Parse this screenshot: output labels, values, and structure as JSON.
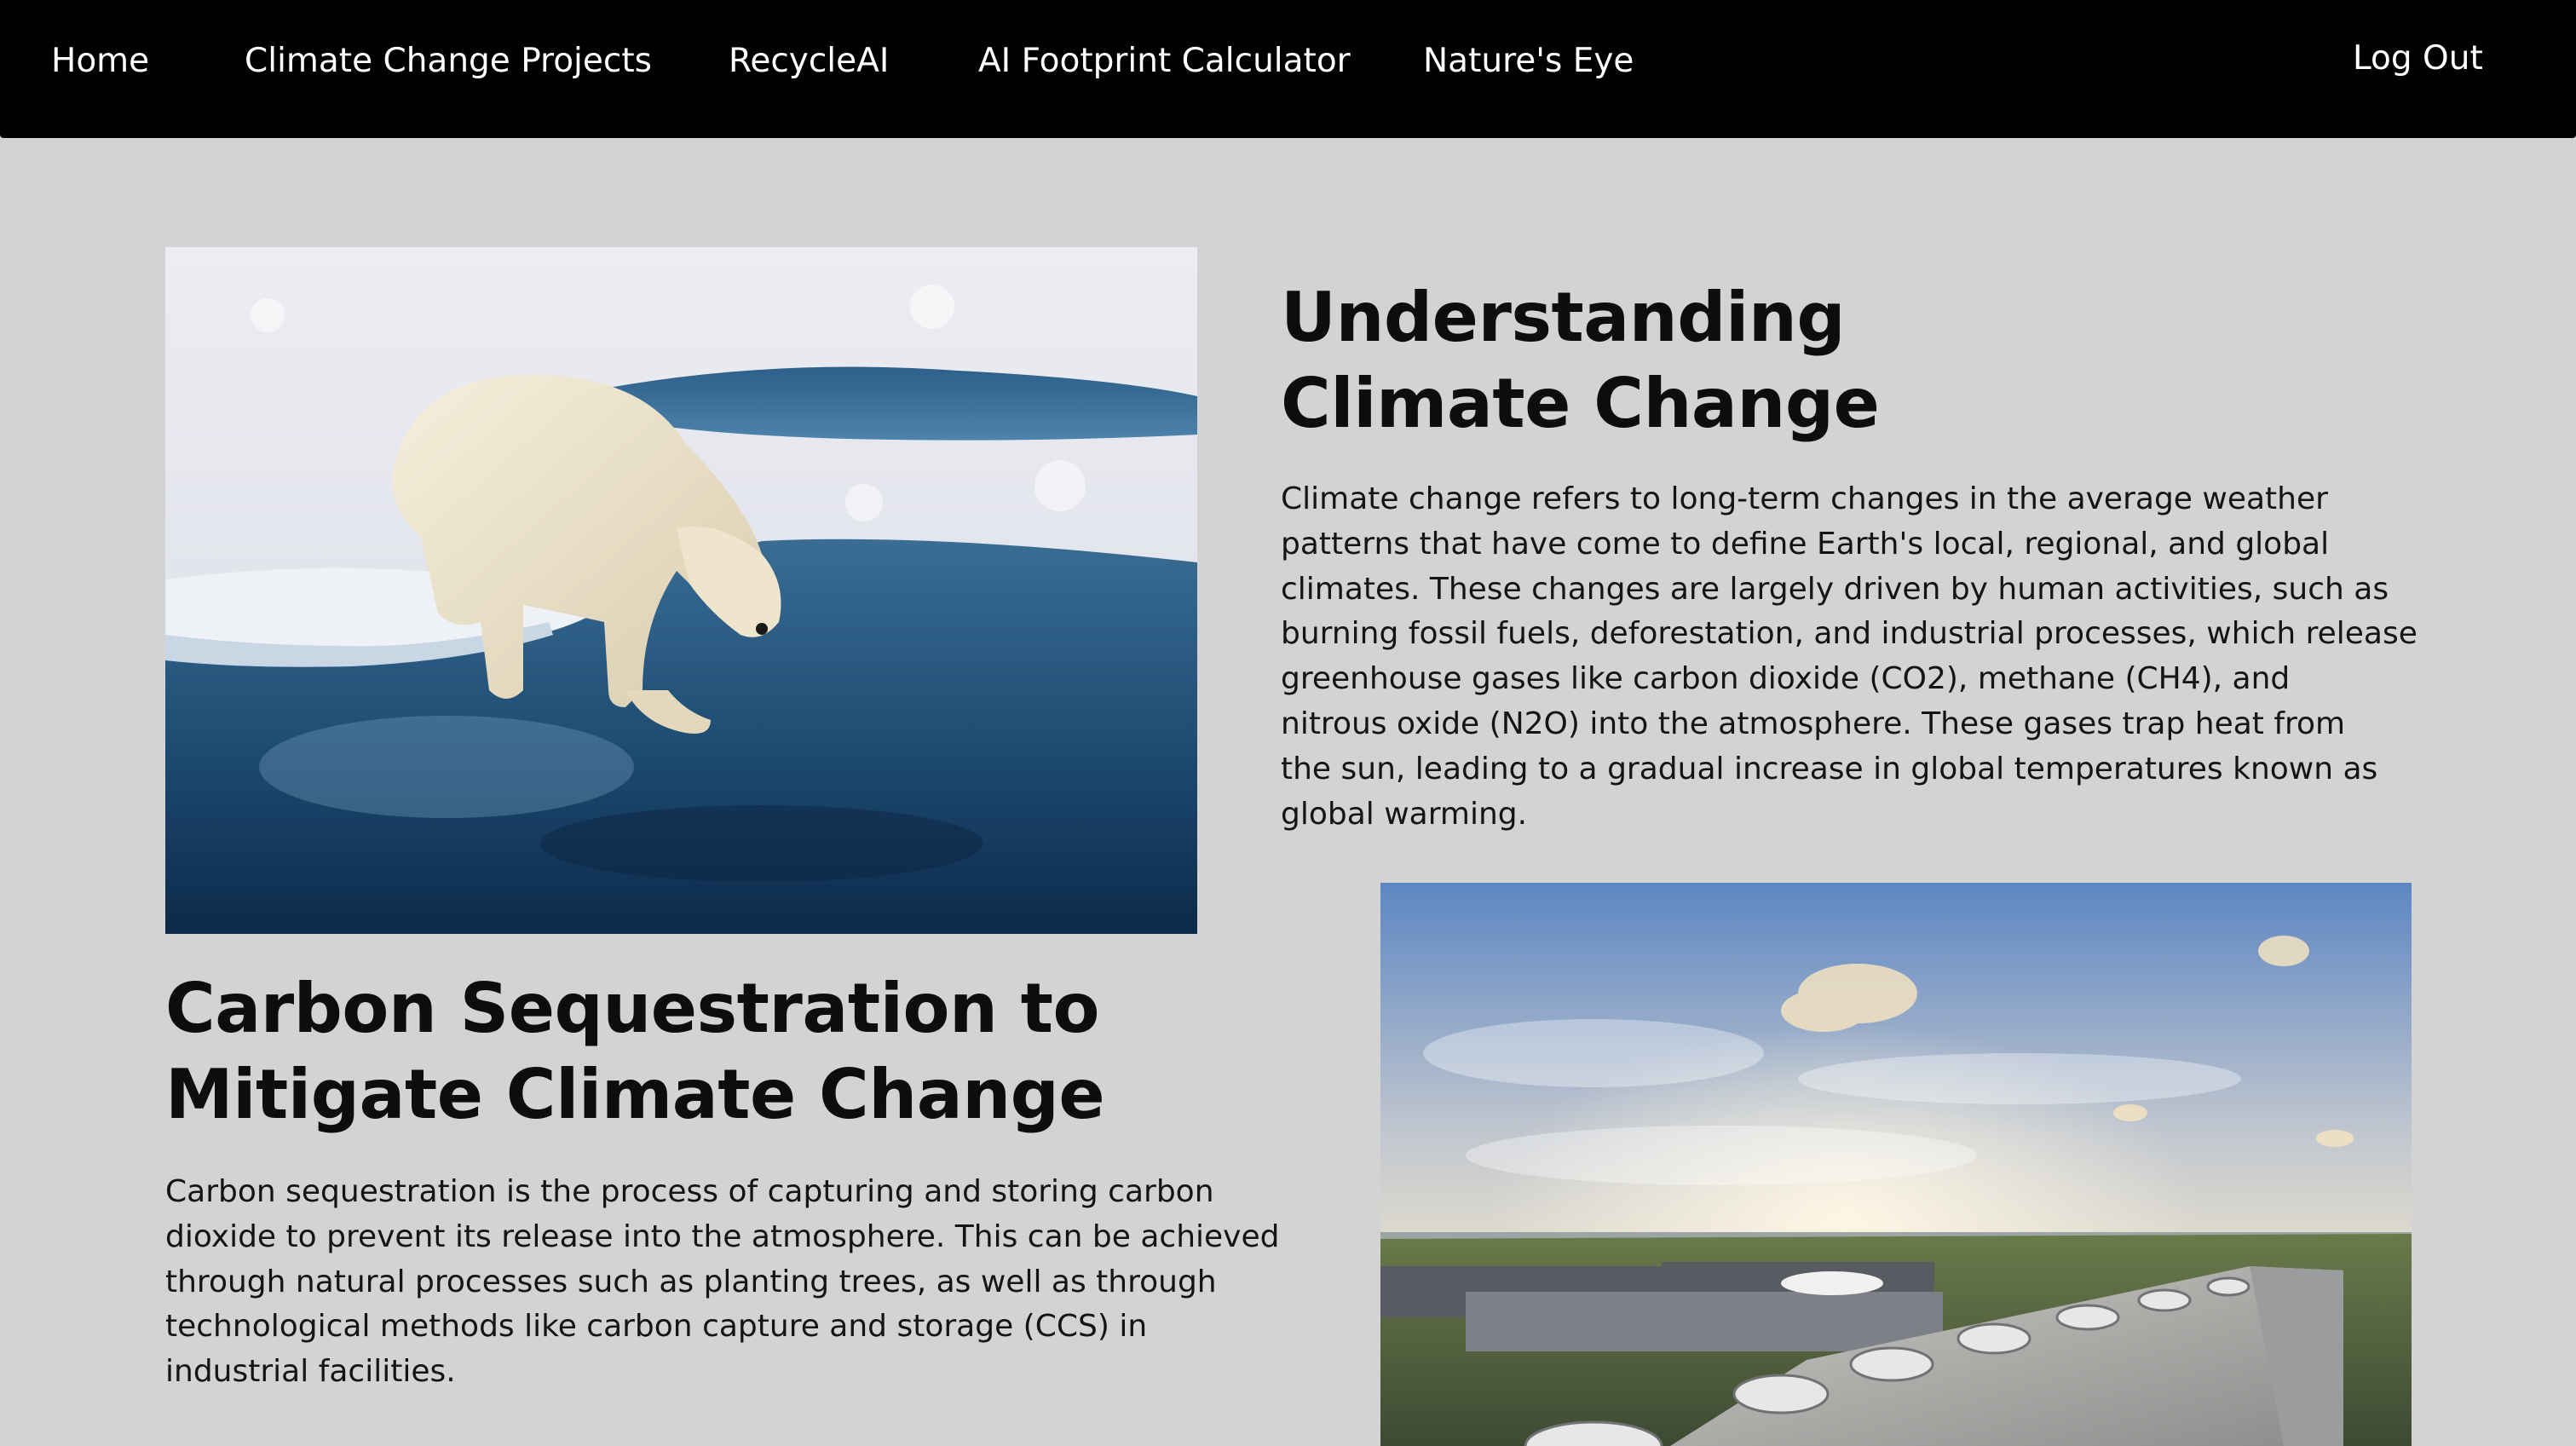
{
  "nav": {
    "home": "Home",
    "climate_projects": "Climate Change Projects",
    "recycle_ai": "RecycleAI",
    "footprint_calculator": "AI Footprint Calculator",
    "natures_eye": "Nature's Eye",
    "logout": "Log Out"
  },
  "section_climate": {
    "title_lines": [
      "Understanding",
      "Climate Change"
    ],
    "body_lines": [
      "Climate change refers to long-term changes in the average weather",
      "patterns that have come to define Earth's local, regional, and global",
      "climates. These changes are largely driven by human activities, such as",
      "burning fossil fuels, deforestation, and industrial processes, which release",
      "greenhouse gases like carbon dioxide (CO2), methane (CH4), and",
      "nitrous oxide (N2O) into the atmosphere. These gases trap heat from",
      "the sun, leading to a gradual increase in global temperatures known as",
      "global warming."
    ]
  },
  "section_carbon": {
    "title_lines": [
      "Carbon Sequestration to",
      "Mitigate Climate Change"
    ],
    "body_lines": [
      "Carbon sequestration is the process of capturing and storing carbon",
      "dioxide to prevent its release into the atmosphere. This can be achieved",
      "through natural processes such as planting trees, as well as through",
      "technological methods like carbon capture and storage (CCS) in",
      "industrial facilities."
    ]
  },
  "colors": {
    "nav_background": "#000000",
    "page_background": "#d3d3d3",
    "text": "#111111"
  }
}
